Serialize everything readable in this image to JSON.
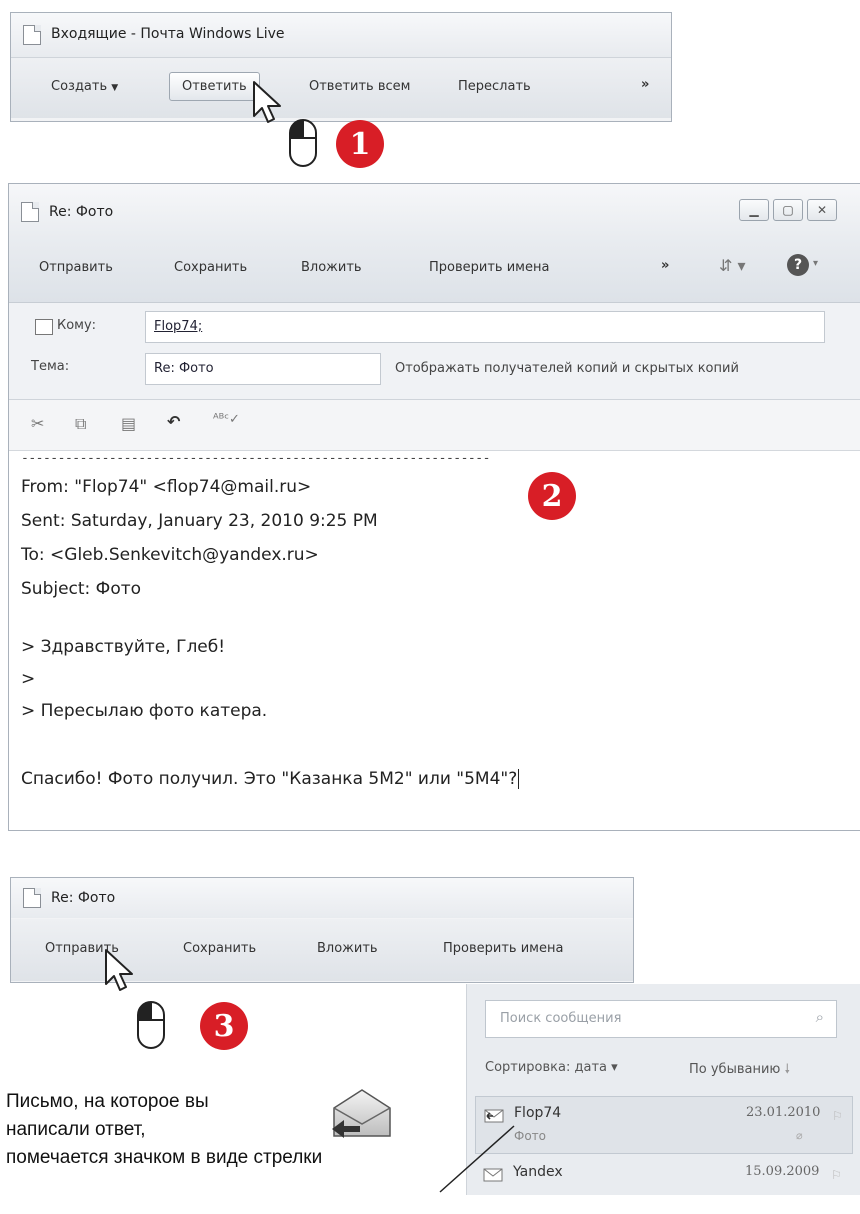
{
  "panel1": {
    "title": "Входящие - Почта Windows Live",
    "toolbar": {
      "create": "Создать",
      "reply": "Ответить",
      "reply_all": "Ответить всем",
      "forward": "Переслать",
      "more": "»"
    },
    "step": "1"
  },
  "panel2": {
    "title": "Re: Фото",
    "toolbar": {
      "send": "Отправить",
      "save": "Сохранить",
      "attach": "Вложить",
      "check_names": "Проверить имена",
      "more": "»"
    },
    "to_label": "Кому:",
    "to_value": "Flop74;",
    "subject_label": "Тема:",
    "subject_value": "Re: Фото",
    "cc_link": "Отображать получателей копий и скрытых копий",
    "body": {
      "separator": "----------------------------------------------------------------",
      "from": "From: \"Flop74\" <flop74@mail.ru>",
      "sent": "Sent: Saturday, January 23, 2010 9:25 PM",
      "to": "To: <Gleb.Senkevitch@yandex.ru>",
      "subject": "Subject: Фото",
      "quote1": "> Здравствуйте, Глеб!",
      "quote2": ">",
      "quote3": "> Пересылаю фото катера.",
      "reply": "Спасибо! Фото получил. Это \"Казанка 5М2\" или \"5М4\"?"
    },
    "step": "2"
  },
  "panel3": {
    "title": "Re: Фото",
    "toolbar": {
      "send": "Отправить",
      "save": "Сохранить",
      "attach": "Вложить",
      "check_names": "Проверить имена"
    },
    "step": "3"
  },
  "message_list": {
    "search_placeholder": "Поиск сообщения",
    "sort_label": "Сортировка: дата ▾",
    "order_label": "По убыванию",
    "messages": [
      {
        "from": "Flop74",
        "subject": "Фото",
        "date": "23.01.2010",
        "icon": "replied-envelope-icon"
      },
      {
        "from": "Yandex",
        "subject": "",
        "date": "15.09.2009",
        "icon": "envelope-icon"
      }
    ]
  },
  "caption": {
    "line1": "Письмо, на которое вы",
    "line2": "написали ответ,",
    "line3": "помечается значком в виде стрелки"
  },
  "colors": {
    "badge": "#d81e26",
    "window_border": "#a9b1bb",
    "toolbar_bg": "#e3e7ec"
  }
}
